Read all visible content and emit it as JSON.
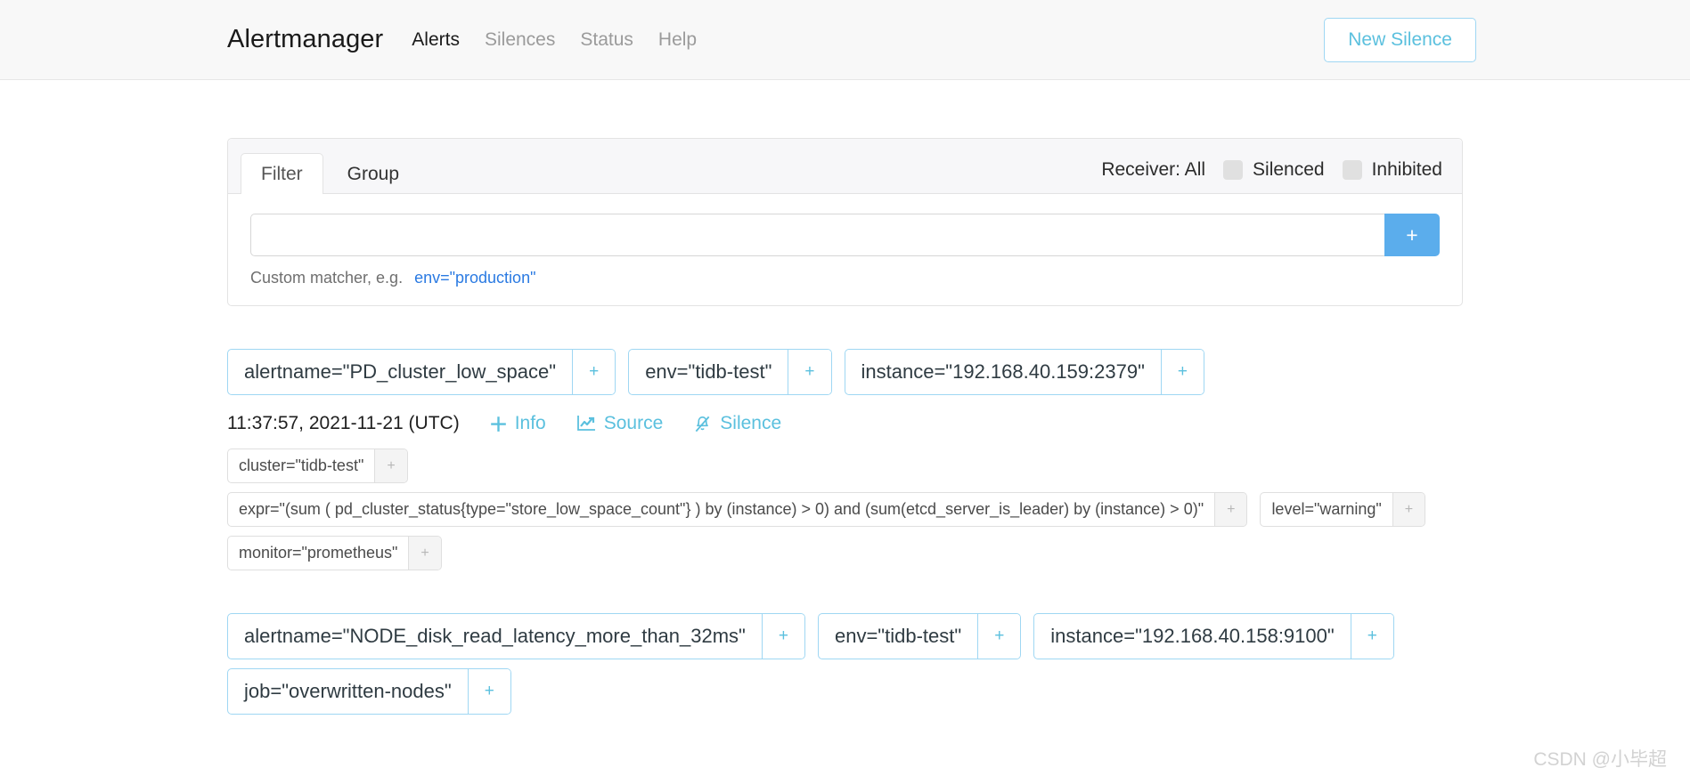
{
  "navbar": {
    "brand": "Alertmanager",
    "links": [
      {
        "label": "Alerts",
        "active": true
      },
      {
        "label": "Silences",
        "active": false
      },
      {
        "label": "Status",
        "active": false
      },
      {
        "label": "Help",
        "active": false
      }
    ],
    "new_silence_label": "New Silence",
    "accent_color": "#5bc0de"
  },
  "filter_card": {
    "tabs": [
      {
        "label": "Filter",
        "active": true
      },
      {
        "label": "Group",
        "active": false
      }
    ],
    "receiver_label": "Receiver: All",
    "toggles": [
      {
        "label": "Silenced",
        "checked": false
      },
      {
        "label": "Inhibited",
        "checked": false
      }
    ],
    "matcher_input_value": "",
    "matcher_input_placeholder": "",
    "add_button_label": "+",
    "hint_text": "Custom matcher, e.g.",
    "hint_example": "env=\"production\"",
    "hint_example_color": "#2a7ae2"
  },
  "alerts": [
    {
      "primary_chips": [
        {
          "text": "alertname=\"PD_cluster_low_space\"",
          "add": "+"
        },
        {
          "text": "env=\"tidb-test\"",
          "add": "+"
        },
        {
          "text": "instance=\"192.168.40.159:2379\"",
          "add": "+"
        }
      ],
      "timestamp": "11:37:57, 2021-11-21 (UTC)",
      "actions": [
        {
          "label": "Info",
          "icon": "plus-icon"
        },
        {
          "label": "Source",
          "icon": "chart-line-icon"
        },
        {
          "label": "Silence",
          "icon": "bell-slash-icon"
        }
      ],
      "secondary_rows": [
        [
          {
            "text": "cluster=\"tidb-test\"",
            "add": "+"
          }
        ],
        [
          {
            "text": "expr=\"(sum ( pd_cluster_status{type=\"store_low_space_count\"} ) by (instance) > 0) and (sum(etcd_server_is_leader) by (instance) > 0)\"",
            "add": "+"
          },
          {
            "text": "level=\"warning\"",
            "add": "+"
          }
        ],
        [
          {
            "text": "monitor=\"prometheus\"",
            "add": "+"
          }
        ]
      ]
    },
    {
      "primary_chips": [
        {
          "text": "alertname=\"NODE_disk_read_latency_more_than_32ms\"",
          "add": "+"
        },
        {
          "text": "env=\"tidb-test\"",
          "add": "+"
        },
        {
          "text": "instance=\"192.168.40.158:9100\"",
          "add": "+"
        }
      ],
      "primary_chips_row2": [
        {
          "text": "job=\"overwritten-nodes\"",
          "add": "+"
        }
      ]
    }
  ],
  "watermark": "CSDN @小毕超"
}
